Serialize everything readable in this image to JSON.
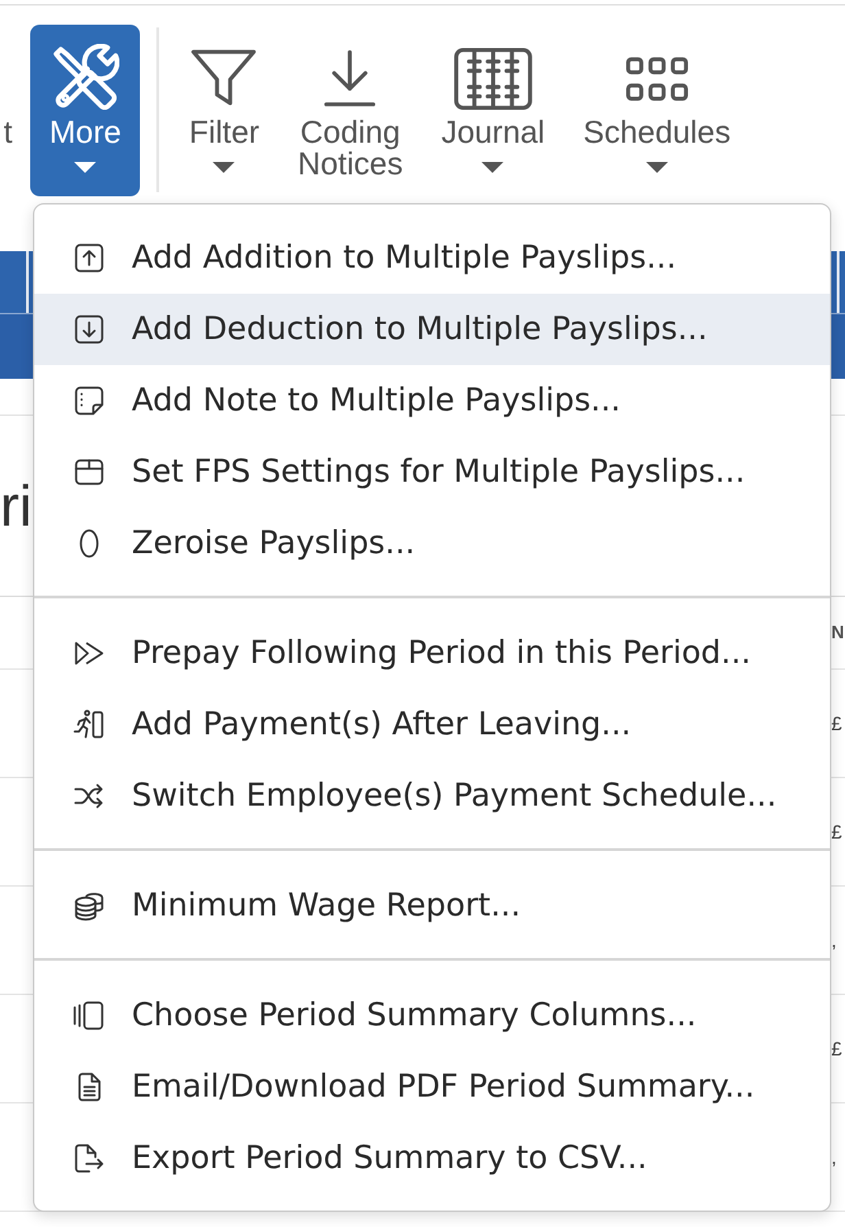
{
  "toolbar": {
    "groups": [
      {
        "buttons": [
          {
            "label": "t",
            "selected": false,
            "dropdown": false
          },
          {
            "label": "More",
            "selected": true,
            "dropdown": true
          }
        ]
      },
      {
        "buttons": [
          {
            "label": "Filter",
            "selected": false,
            "dropdown": true
          },
          {
            "label": "Coding Notices",
            "selected": false,
            "dropdown": false
          },
          {
            "label": "Journal",
            "selected": false,
            "dropdown": true
          },
          {
            "label": "Schedules",
            "selected": false,
            "dropdown": true
          }
        ]
      }
    ]
  },
  "page": {
    "heading": "ri",
    "table": {
      "header": "N",
      "cells": [
        "£",
        "£",
        ",",
        "£",
        ","
      ]
    }
  },
  "menu": {
    "groups": [
      {
        "items": [
          {
            "label": "Add Addition to Multiple Payslips...",
            "selected": false
          },
          {
            "label": "Add Deduction to Multiple Payslips...",
            "selected": true
          },
          {
            "label": "Add Note to Multiple Payslips...",
            "selected": false
          },
          {
            "label": "Set FPS Settings for Multiple Payslips...",
            "selected": false
          },
          {
            "label": "Zeroise Payslips...",
            "selected": false
          }
        ]
      },
      {
        "items": [
          {
            "label": "Prepay Following Period in this Period...",
            "selected": false
          },
          {
            "label": "Add Payment(s) After Leaving...",
            "selected": false
          },
          {
            "label": "Switch Employee(s) Payment Schedule...",
            "selected": false
          }
        ]
      },
      {
        "items": [
          {
            "label": "Minimum Wage Report...",
            "selected": false
          }
        ]
      },
      {
        "items": [
          {
            "label": "Choose Period Summary Columns...",
            "selected": false
          },
          {
            "label": "Email/Download PDF Period Summary...",
            "selected": false
          },
          {
            "label": "Export Period Summary to CSV...",
            "selected": false
          }
        ]
      }
    ]
  }
}
